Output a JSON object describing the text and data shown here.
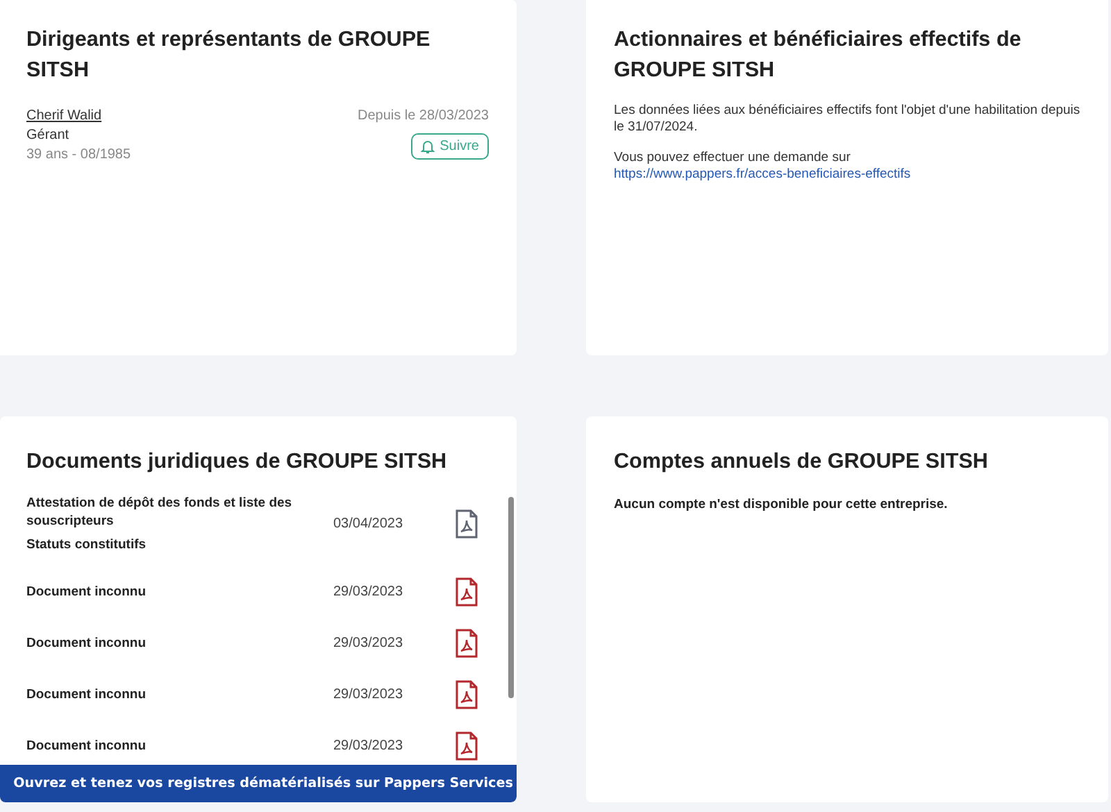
{
  "dirigeants": {
    "title": "Dirigeants et représentants de GROUPE SITSH",
    "people": [
      {
        "name": "Cherif Walid",
        "role": "Gérant",
        "age": "39 ans - 08/1985",
        "since": "Depuis le 28/03/2023",
        "follow": "Suivre"
      }
    ]
  },
  "actionnaires": {
    "title": "Actionnaires et bénéficiaires effectifs de GROUPE SITSH",
    "paragraph_1": "Les données liées aux bénéficiaires effectifs font l'objet d'une habilitation depuis le 31/07/2024.",
    "paragraph_2": "Vous pouvez effectuer une demande sur ",
    "link": "https://www.pappers.fr/acces-beneficiaires-effectifs"
  },
  "documents": {
    "title": "Documents juridiques de GROUPE SITSH",
    "rows": [
      {
        "names": [
          "Attestation de dépôt des fonds et liste des souscripteurs",
          "Statuts constitutifs"
        ],
        "date": "03/04/2023",
        "color": "#5f6470"
      },
      {
        "names": [
          "Document inconnu"
        ],
        "date": "29/03/2023",
        "color": "#b3282d"
      },
      {
        "names": [
          "Document inconnu"
        ],
        "date": "29/03/2023",
        "color": "#b3282d"
      },
      {
        "names": [
          "Document inconnu"
        ],
        "date": "29/03/2023",
        "color": "#b3282d"
      },
      {
        "names": [
          "Document inconnu"
        ],
        "date": "29/03/2023",
        "color": "#b3282d"
      }
    ],
    "banner": "Ouvrez et tenez vos registres dématérialisés sur Pappers Services"
  },
  "comptes": {
    "title": "Comptes annuels de GROUPE SITSH",
    "message": "Aucun compte n'est disponible pour cette entreprise."
  }
}
